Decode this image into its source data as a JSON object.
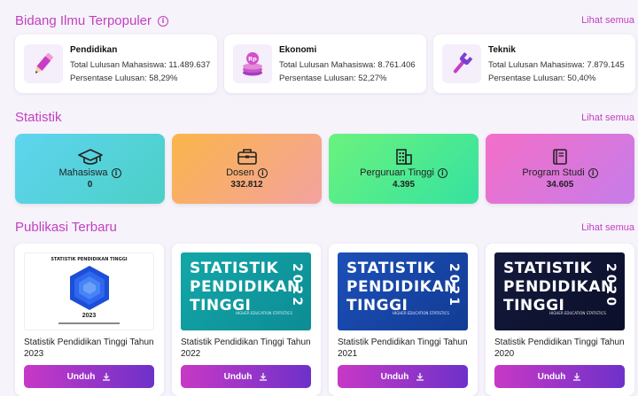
{
  "popular": {
    "title": "Bidang Ilmu Terpopuler",
    "see_all": "Lihat semua",
    "fields": [
      {
        "name": "Pendidikan",
        "graduates": "Total Lulusan Mahasiswa: 11.489.637",
        "percent": "Persentase Lulusan: 58,29%",
        "icon": "pencil-icon"
      },
      {
        "name": "Ekonomi",
        "graduates": "Total Lulusan Mahasiswa: 8.761.406",
        "percent": "Persentase Lulusan: 52,27%",
        "icon": "coins-icon"
      },
      {
        "name": "Teknik",
        "graduates": "Total Lulusan Mahasiswa: 7.879.145",
        "percent": "Persentase Lulusan: 50,40%",
        "icon": "wrench-icon"
      }
    ]
  },
  "stats": {
    "title": "Statistik",
    "see_all": "Lihat semua",
    "items": [
      {
        "label": "Mahasiswa",
        "value": "0",
        "icon": "graduation-cap-icon"
      },
      {
        "label": "Dosen",
        "value": "332.812",
        "icon": "briefcase-icon"
      },
      {
        "label": "Perguruan Tinggi",
        "value": "4.395",
        "icon": "building-icon"
      },
      {
        "label": "Program Studi",
        "value": "34.605",
        "icon": "book-icon"
      }
    ]
  },
  "publications": {
    "title": "Publikasi Terbaru",
    "see_all": "Lihat semua",
    "download_label": "Unduh",
    "items": [
      {
        "title": "Statistik Pendidikan Tinggi Tahun 2023",
        "cover_title": "STATISTIK PENDIDIKAN TINGGI",
        "cover_year": "2023"
      },
      {
        "title": "Statistik Pendidikan Tinggi Tahun 2022",
        "cover_lines": [
          "STATISTIK",
          "PENDIDIKAN",
          "TINGGI"
        ],
        "cover_year": "2022",
        "cover_sub": "HIGHER EDUCATION STATISTICS"
      },
      {
        "title": "Statistik Pendidikan Tinggi Tahun 2021",
        "cover_lines": [
          "STATISTIK",
          "PENDIDIKAN",
          "TINGGI"
        ],
        "cover_year": "2021",
        "cover_sub": "HIGHER EDUCATION STATISTICS"
      },
      {
        "title": "Statistik Pendidikan Tinggi Tahun 2020",
        "cover_lines": [
          "STATISTIK",
          "PENDIDIKAN",
          "TINGGI"
        ],
        "cover_year": "2020",
        "cover_sub": "HIGHER EDUCATION STATISTICS"
      }
    ]
  },
  "colors": {
    "accent": "#c33fbf",
    "button_start": "#c838c6",
    "button_end": "#6d31c9"
  }
}
